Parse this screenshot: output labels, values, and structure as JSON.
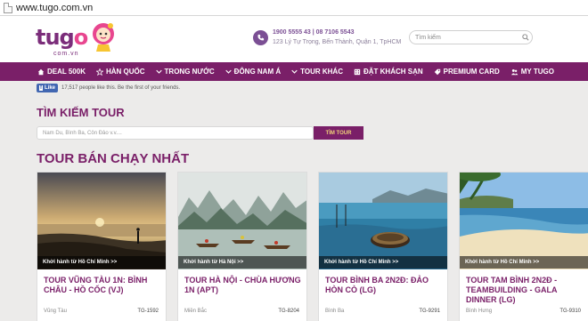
{
  "browser": {
    "url": "www.tugo.com.vn"
  },
  "header": {
    "logo_text_main": "tug",
    "logo_text_o": "o",
    "logo_sub": "com.vn",
    "phones": "1900 5555 43 | 08 7106 5543",
    "address": "123 Lý Tự Trọng, Bến Thành, Quận 1, TpHCM",
    "search_placeholder": "Tìm kiếm"
  },
  "nav": {
    "items": [
      {
        "label": "DEAL 500K",
        "icon": "home-icon"
      },
      {
        "label": "HÀN QUỐC",
        "icon": "star-icon"
      },
      {
        "label": "TRONG NƯỚC",
        "icon": "chevron-down-icon"
      },
      {
        "label": "ĐÔNG NAM Á",
        "icon": "chevron-down-icon"
      },
      {
        "label": "TOUR KHÁC",
        "icon": "chevron-down-icon"
      },
      {
        "label": "ĐẶT KHÁCH SẠN",
        "icon": "hotel-icon"
      },
      {
        "label": "PREMIUM CARD",
        "icon": "tag-icon"
      },
      {
        "label": "MY TUGO",
        "icon": "users-icon"
      }
    ]
  },
  "facebook": {
    "button_label": "Like",
    "button_letter": "f",
    "text": "17,517 people like this. Be the first of your friends."
  },
  "tour_search": {
    "title": "TÌM KIẾM TOUR",
    "placeholder": "Nam Du, Bình Ba, Côn Đảo v.v....",
    "button_label": "TÌM TOUR"
  },
  "bestsellers": {
    "title": "TOUR BÁN CHẠY NHẤT",
    "cards": [
      {
        "depart": "Khởi hành từ Hồ Chí Minh >>",
        "name": "TOUR VŨNG TÀU 1N: BÌNH CHÂU - HỒ CỐC (VJ)",
        "region": "Vũng Tàu",
        "code": "TG-1592"
      },
      {
        "depart": "Khởi hành từ Hà Nội >>",
        "name": "TOUR HÀ NỘI - CHÙA HƯƠNG 1N (APT)",
        "region": "Miền Bắc",
        "code": "TG-8204"
      },
      {
        "depart": "Khởi hành từ Hồ Chí Minh >>",
        "name": "TOUR BÌNH BA 2N2Đ: ĐẢO HÒN CÒ (LG)",
        "region": "Bình Ba",
        "code": "TG-9291"
      },
      {
        "depart": "Khởi hành từ Hồ Chí Minh >>",
        "name": "TOUR TAM BÌNH 2N2Đ - TEAMBUILDING - GALA DINNER (LG)",
        "region": "Bình Hưng",
        "code": "TG-9310"
      }
    ]
  },
  "colors": {
    "brand_purple": "#7a1f68",
    "accent_pink": "#e8468f",
    "button_text_gold": "#f0d27a"
  }
}
